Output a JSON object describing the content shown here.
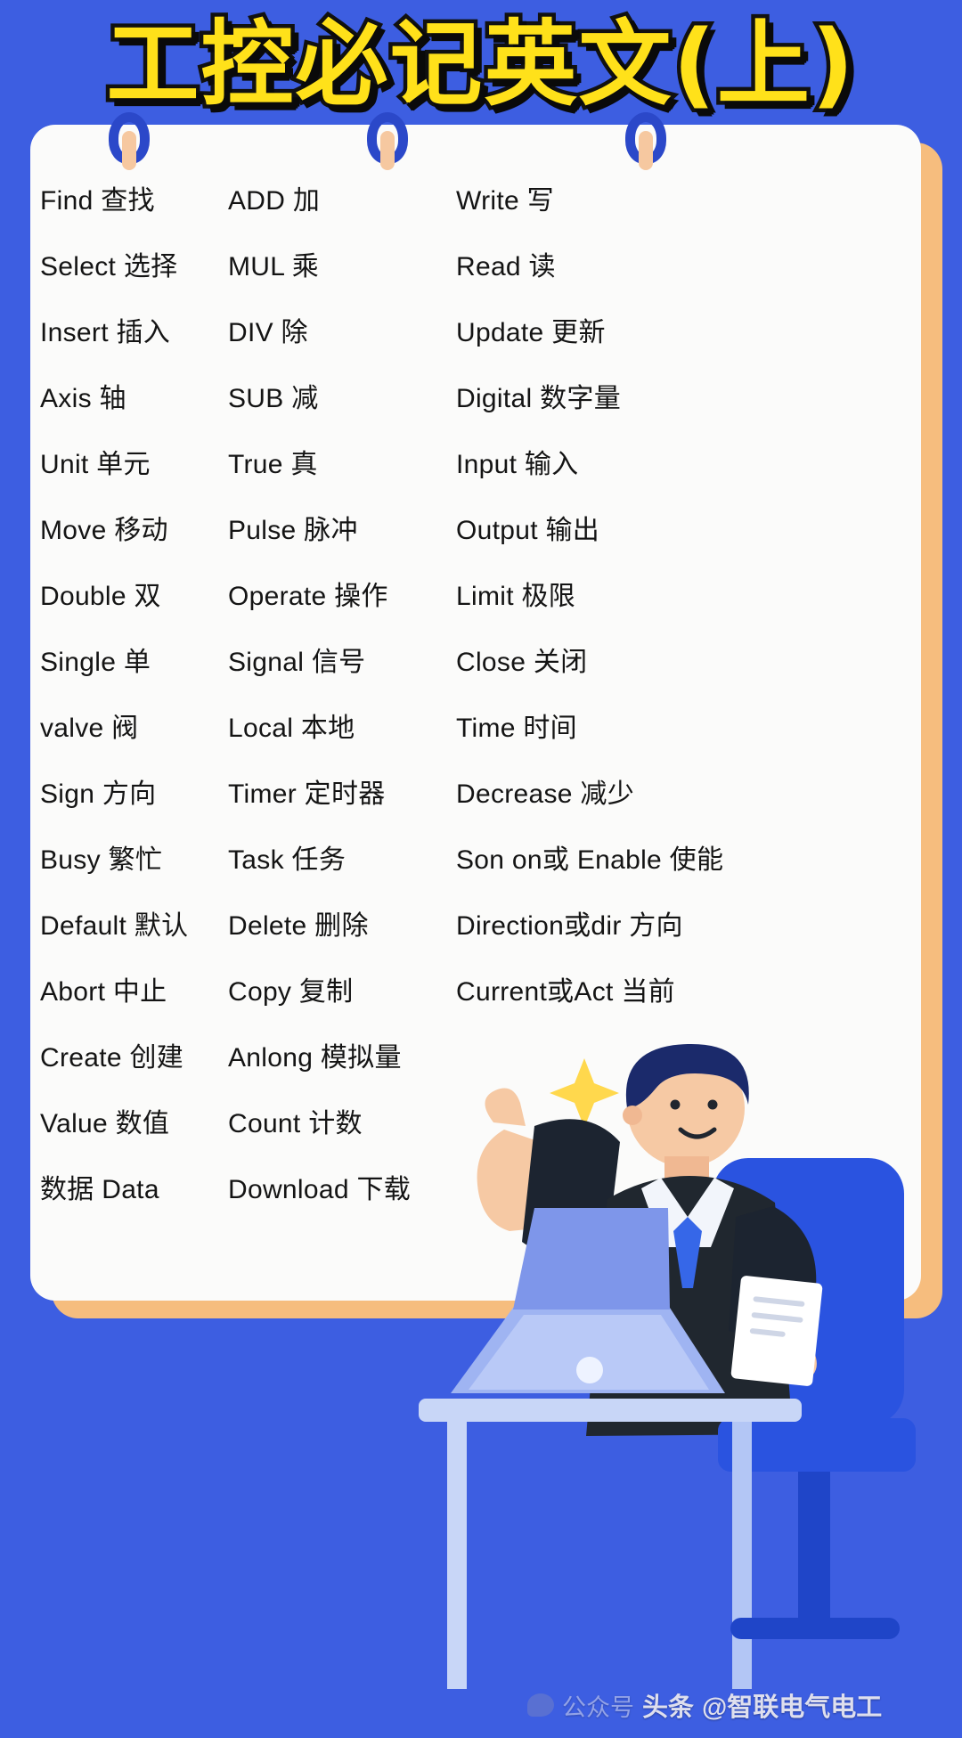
{
  "poster": {
    "title": "工控必记英文(上)",
    "accent_yellow": "#ffe11a",
    "background_blue": "#3d5ee1",
    "card_white": "#fbfbfa",
    "card_shadow_orange": "#f6bd7e",
    "ring_blue": "#2b48c9"
  },
  "columns": [
    {
      "name": "column-1",
      "entries": [
        "Find 查找",
        "Select 选择",
        "Insert 插入",
        "Axis 轴",
        "Unit 单元",
        "Move 移动",
        "Double 双",
        "Single 单",
        "valve 阀",
        "Sign 方向",
        "Busy 繁忙",
        "Default 默认",
        "Abort 中止",
        "Create 创建",
        "Value 数值",
        "数据 Data"
      ]
    },
    {
      "name": "column-2",
      "entries": [
        "ADD 加",
        "MUL 乘",
        "DIV 除",
        "SUB 减",
        "True 真",
        "Pulse 脉冲",
        "Operate 操作",
        "Signal 信号",
        "Local 本地",
        "Timer 定时器",
        "Task 任务",
        "Delete 删除",
        "Copy 复制",
        "Anlong 模拟量",
        "Count 计数",
        "Download 下载"
      ]
    },
    {
      "name": "column-3",
      "entries": [
        "Write 写",
        "Read 读",
        "Update 更新",
        "Digital 数字量",
        "Input 输入",
        "Output 输出",
        "Limit 极限",
        "Close 关闭",
        "Time 时间",
        "Decrease 减少",
        "Son on或 Enable 使能",
        "Direction或dir 方向",
        "Current或Act 当前"
      ]
    }
  ],
  "watermark": {
    "gongzhonghao": "公众号",
    "platform": "头条",
    "account": "@智联电气电工"
  }
}
